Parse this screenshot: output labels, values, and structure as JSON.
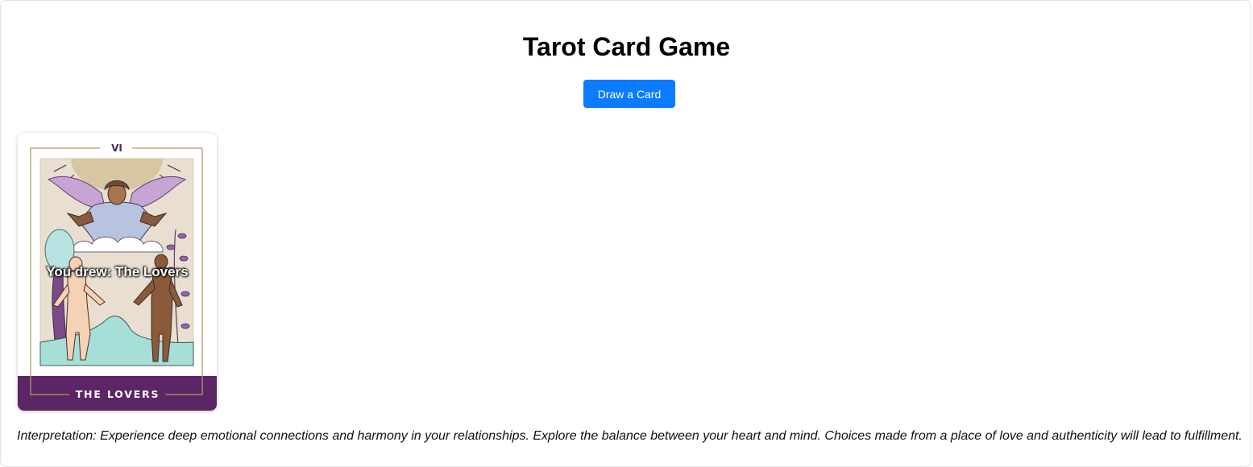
{
  "page": {
    "title": "Tarot Card Game"
  },
  "controls": {
    "draw_button_label": "Draw a Card"
  },
  "card": {
    "numeral": "VI",
    "name": "THE LOVERS",
    "drawn_message": "You drew: The Lovers",
    "colors": {
      "banner": "#5b2566",
      "border_gold": "#b09a6a",
      "background": "#e9dfd0"
    }
  },
  "result": {
    "interpretation": "Interpretation: Experience deep emotional connections and harmony in your relationships. Explore the balance between your heart and mind. Choices made from a place of love and authenticity will lead to fulfillment."
  },
  "colors": {
    "button": "#0b7bff"
  }
}
